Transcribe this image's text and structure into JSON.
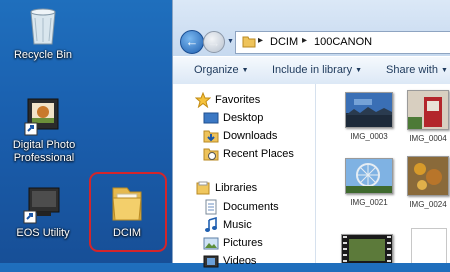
{
  "desktop": {
    "icons": [
      {
        "label": "Recycle Bin"
      },
      {
        "label": "Digital Photo Professional"
      },
      {
        "label": "EOS Utility"
      },
      {
        "label": "DCIM"
      }
    ]
  },
  "window": {
    "address": {
      "crumbs": [
        "DCIM",
        "100CANON"
      ]
    },
    "toolbar": {
      "organize": "Organize",
      "include": "Include in library",
      "share": "Share with"
    },
    "nav_pane": {
      "favorites": "Favorites",
      "desktop": "Desktop",
      "downloads": "Downloads",
      "recent": "Recent Places",
      "libraries": "Libraries",
      "documents": "Documents",
      "music": "Music",
      "pictures": "Pictures",
      "videos": "Videos"
    },
    "files": [
      {
        "name": "IMG_0003"
      },
      {
        "name": "IMG_0004"
      },
      {
        "name": "IMG_0021"
      },
      {
        "name": "IMG_0024"
      }
    ]
  },
  "colors": {
    "selection_ring": "#d4252a",
    "desktop_bg": "#1a5fae"
  }
}
